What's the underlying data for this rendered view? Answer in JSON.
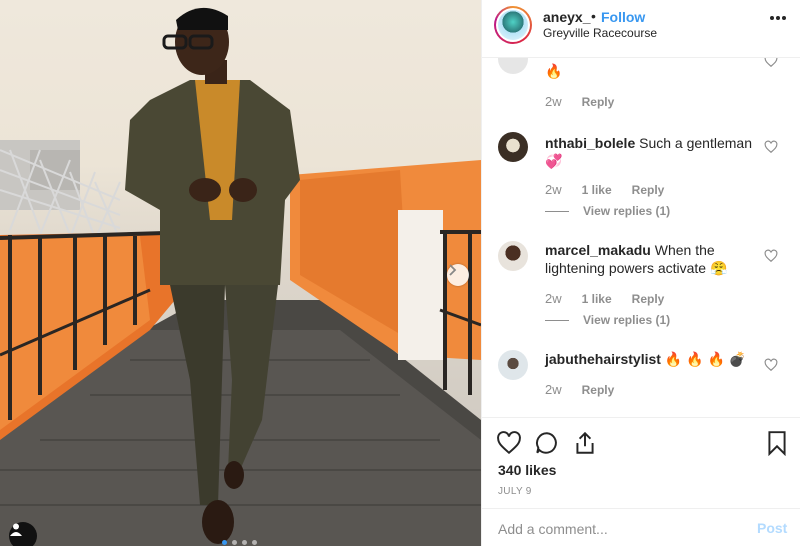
{
  "header": {
    "username": "aneyx_",
    "separator": "•",
    "follow_label": "Follow",
    "location": "Greyville Racecourse",
    "more_icon": "more-options-icon"
  },
  "comments": [
    {
      "username": "",
      "text": "🔥",
      "age": "2w",
      "likes": "",
      "reply_label": "Reply",
      "view_replies": ""
    },
    {
      "username": "nthabi_bolele",
      "text": "Such a gentleman 💞",
      "age": "2w",
      "likes": "1 like",
      "reply_label": "Reply",
      "view_replies": "View replies (1)"
    },
    {
      "username": "marcel_makadu",
      "text": "When the lightening powers activate 😤",
      "age": "2w",
      "likes": "1 like",
      "reply_label": "Reply",
      "view_replies": "View replies (1)"
    },
    {
      "username": "jabuthehairstylist",
      "text": "🔥 🔥 🔥 💣",
      "age": "2w",
      "likes": "",
      "reply_label": "Reply",
      "view_replies": ""
    }
  ],
  "actions": {
    "like_icon": "heart-icon",
    "comment_icon": "comment-bubble-icon",
    "share_icon": "share-icon",
    "save_icon": "bookmark-icon"
  },
  "likes_count": "340 likes",
  "post_date": "JULY 9",
  "comment_box": {
    "placeholder": "Add a comment...",
    "post_label": "Post"
  },
  "carousel": {
    "slide_count": 4,
    "active_index": 1
  },
  "colors": {
    "accent_blue": "#3897f0",
    "post_disabled": "#b3dbff",
    "muted_text": "#8e8e8e",
    "border": "#efefef"
  }
}
